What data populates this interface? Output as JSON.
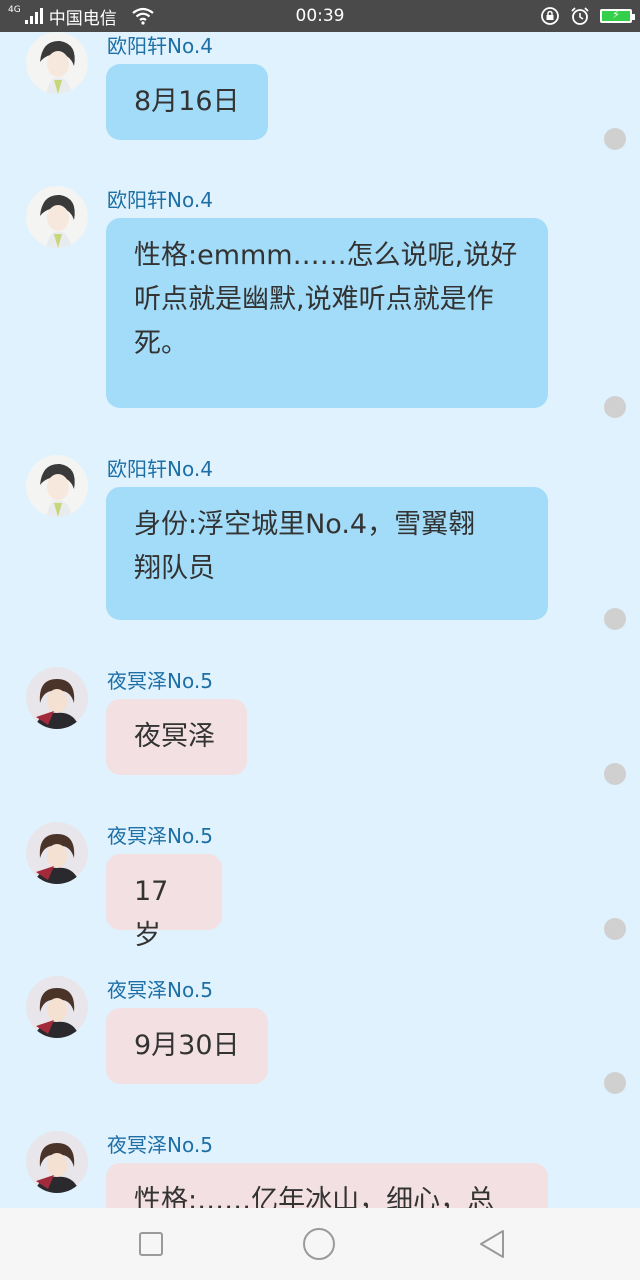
{
  "status_bar": {
    "network_badge": "4G",
    "carrier": "中国电信",
    "time": "00:39",
    "icons": [
      "signal-icon",
      "wifi-icon",
      "lock-rotation-icon",
      "alarm-icon",
      "battery-charging-icon"
    ]
  },
  "messages": [
    {
      "sender": "欧阳轩No.4",
      "text": "8月16日",
      "color": "blue"
    },
    {
      "sender": "欧阳轩No.4",
      "lines": [
        "性格:emmm……怎么说呢,说好",
        "听点就是幽默,说难听点就是作",
        "死。"
      ],
      "color": "blue"
    },
    {
      "sender": "欧阳轩No.4",
      "lines": [
        "身份:浮空城里No.4，雪翼翱",
        "翔队员"
      ],
      "color": "blue"
    },
    {
      "sender": "夜冥泽No.5",
      "text": "夜冥泽",
      "color": "pink"
    },
    {
      "sender": "夜冥泽No.5",
      "text": "17岁",
      "color": "pink"
    },
    {
      "sender": "夜冥泽No.5",
      "text": "9月30日",
      "color": "pink"
    },
    {
      "sender": "夜冥泽No.5",
      "text": "性格:……亿年冰山，细心，总",
      "color": "pink"
    }
  ],
  "colors": {
    "bubble_blue": "#a3dcf8",
    "bubble_pink": "#f3e0e3",
    "sender_name": "#1d6fa5",
    "background": "#dff2fd"
  },
  "nav_bar": {
    "icons": [
      "recent-apps-icon",
      "home-icon",
      "back-icon"
    ]
  }
}
